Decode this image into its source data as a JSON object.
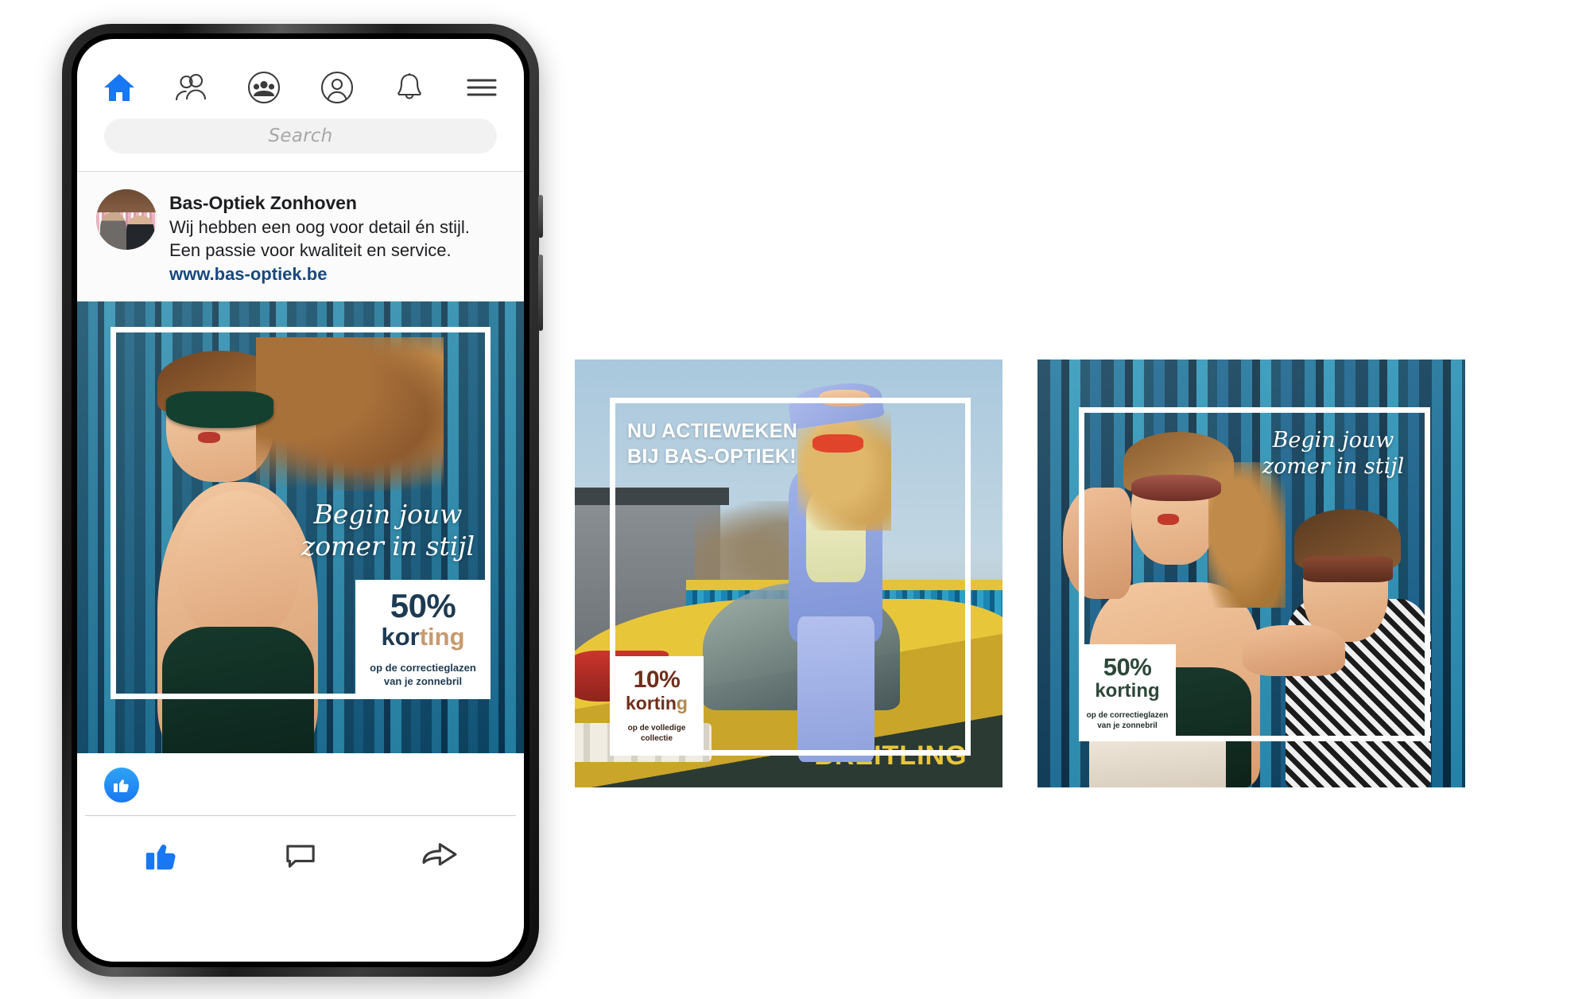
{
  "app": {
    "nav_items": [
      {
        "name": "home",
        "icon": "home-icon",
        "active": true
      },
      {
        "name": "friends",
        "icon": "friends-icon",
        "active": false
      },
      {
        "name": "groups",
        "icon": "groups-icon",
        "active": false
      },
      {
        "name": "profile",
        "icon": "profile-icon",
        "active": false
      },
      {
        "name": "notifications",
        "icon": "bell-icon",
        "active": false
      },
      {
        "name": "menu",
        "icon": "hamburger-menu-icon",
        "active": false
      }
    ],
    "accent_color": "#1877f2",
    "search": {
      "placeholder": "Search",
      "value": ""
    }
  },
  "post": {
    "page_name": "Bas-Optiek Zonhoven",
    "line1": "Wij hebben een oog voor detail én stijl.",
    "line2": "Een passie voor kwaliteit en service.",
    "url": "www.bas-optiek.be",
    "reaction": "like-reaction",
    "actions": [
      {
        "label": "like",
        "icon": "thumbs-up-icon"
      },
      {
        "label": "comment",
        "icon": "comment-bubble-icon"
      },
      {
        "label": "share",
        "icon": "share-arrow-icon"
      }
    ]
  },
  "creatives": [
    {
      "id": "ad-phone",
      "headline": "",
      "script_text": "Begin jouw\nzomer in stijl",
      "badge": {
        "percent": "50%",
        "korting_dark": "kor",
        "korting_accent": "ting",
        "sub_line1": "op de correctieglazen",
        "sub_line2": "van je zonnebril",
        "color_dark": "#1d3a52",
        "color_accent": "#c79a6f"
      }
    },
    {
      "id": "ad-aviation",
      "headline": "NU ACTIEWEKEN\nBIJ BAS-OPTIEK!",
      "script_text": "",
      "badge": {
        "percent": "10%",
        "korting_dark": "kortin",
        "korting_accent": "g",
        "sub_line1": "op de volledige",
        "sub_line2": "collectie",
        "color_dark": "#6e2f1c",
        "color_accent": "#b08a52"
      }
    },
    {
      "id": "ad-couple",
      "headline": "",
      "script_text": "Begin jouw\nzomer in stijl",
      "badge": {
        "percent": "50%",
        "korting_dark": "korting",
        "korting_accent": "",
        "sub_line1": "op de correctieglazen",
        "sub_line2": "van je zonnebril",
        "color_dark": "#2d4739",
        "color_accent": "#2d4739"
      }
    }
  ]
}
